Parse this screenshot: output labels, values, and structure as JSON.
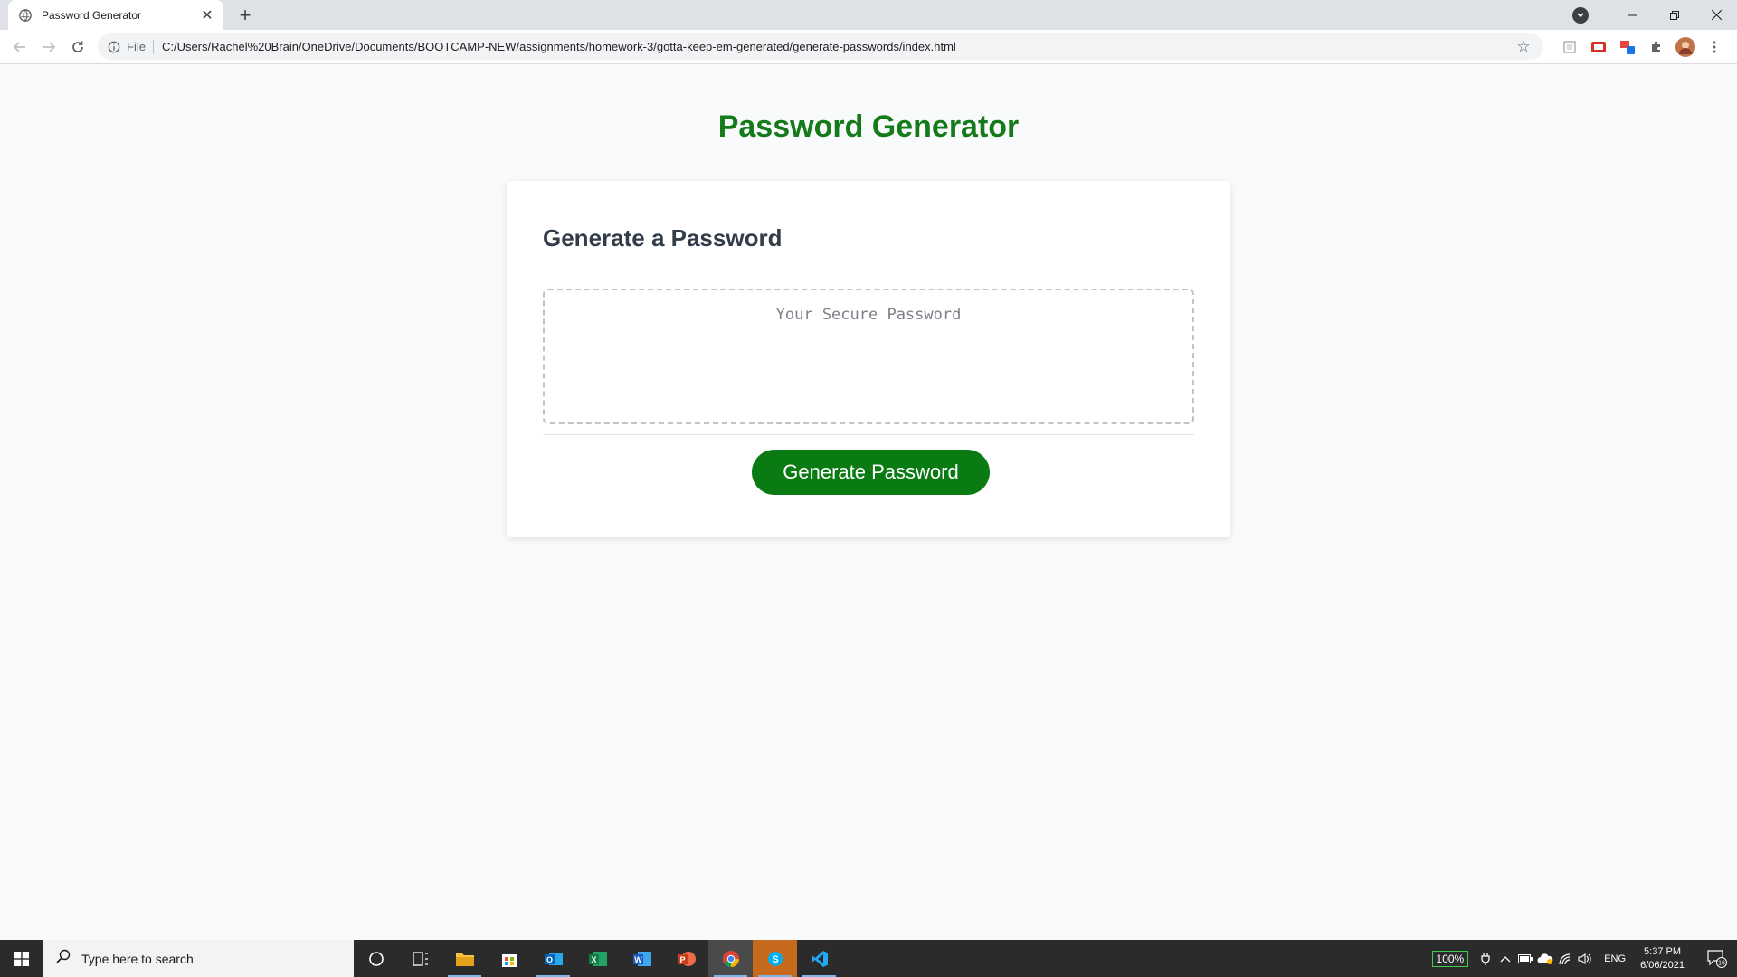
{
  "browser": {
    "tab": {
      "title": "Password Generator"
    },
    "address": {
      "scheme": "File",
      "url": "C:/Users/Rachel%20Brain/OneDrive/Documents/BOOTCAMP-NEW/assignments/homework-3/gotta-keep-em-generated/generate-passwords/index.html"
    }
  },
  "page": {
    "title": "Password Generator",
    "card": {
      "heading": "Generate a Password",
      "password_placeholder": "Your Secure Password",
      "password_value": "",
      "button_label": "Generate Password"
    }
  },
  "taskbar": {
    "search_placeholder": "Type here to search",
    "battery": "100%",
    "language": "ENG",
    "time": "5:37 PM",
    "date": "6/06/2021",
    "notifications": "16"
  },
  "colors": {
    "accent_green": "#0a7a12",
    "title_green": "#157a1a",
    "heading": "#333d49"
  }
}
